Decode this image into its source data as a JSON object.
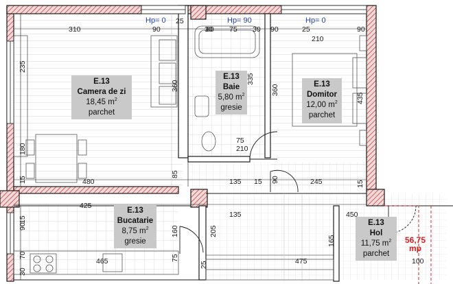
{
  "rooms": [
    {
      "code": "E.13",
      "name": "Camera de zi",
      "area": "18,45 m",
      "finish": "parchet"
    },
    {
      "code": "E.13",
      "name": "Baie",
      "area": "5,80 m",
      "finish": "gresie"
    },
    {
      "code": "E.13",
      "name": "Domitor",
      "area": "12,00 m",
      "finish": "parchet"
    },
    {
      "code": "E.13",
      "name": "Bucatarie",
      "area": "8,75 m",
      "finish": "gresie"
    },
    {
      "code": "E.13",
      "name": "Hol",
      "area": "11,75 m",
      "finish": "parchet"
    }
  ],
  "area_unit_exp": "2",
  "total": {
    "value": "56,75",
    "unit": "mp"
  },
  "hp_marks": [
    "Hp= 0",
    "Hp= 90",
    "Hp= 0"
  ],
  "dimensions": {
    "h": [
      "310",
      "90",
      "25",
      "80",
      "75",
      "30",
      "90",
      "210",
      "25",
      "90",
      "210",
      "75",
      "480",
      "135",
      "15",
      "245",
      "425",
      "135",
      "450",
      "465",
      "475",
      "100",
      "30"
    ],
    "v": [
      "235",
      "360",
      "335",
      "360",
      "435",
      "180",
      "85",
      "15",
      "90",
      "15",
      "160",
      "205",
      "165",
      "75",
      "20",
      "30",
      "90",
      "70",
      "25",
      "15"
    ]
  },
  "colors": {
    "wall_hatch": "#c43030",
    "wall": "#1a1a1a",
    "label_bg": "#c9c9c9",
    "grid": "#bdbdbd",
    "hp": "#1f3fbf",
    "total": "#d42020"
  }
}
